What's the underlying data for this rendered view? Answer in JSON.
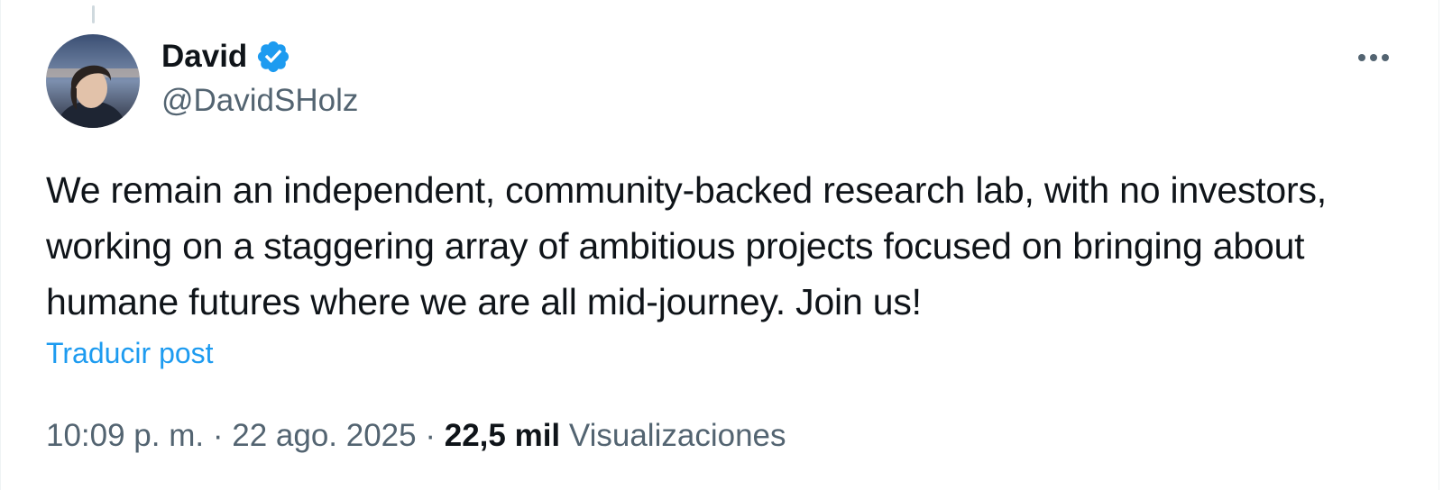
{
  "tweet": {
    "author": {
      "display_name": "David",
      "handle": "@DavidSHolz",
      "verified_icon": "verified-badge-icon",
      "avatar_icon": "user-avatar"
    },
    "more_icon": "more-options-icon",
    "text": "We remain an independent, community-backed research lab, with no investors, working on a staggering array of ambitious projects focused on bringing about humane futures where we are all mid-journey. Join us!",
    "translate_label": "Traducir post",
    "meta": {
      "time": "10:09 p. m.",
      "separator": "·",
      "date": "22 ago. 2025",
      "views_count": "22,5 mil",
      "views_label": "Visualizaciones"
    }
  },
  "colors": {
    "accent": "#1d9bf0",
    "text_primary": "#0f1419",
    "text_secondary": "#536471"
  }
}
